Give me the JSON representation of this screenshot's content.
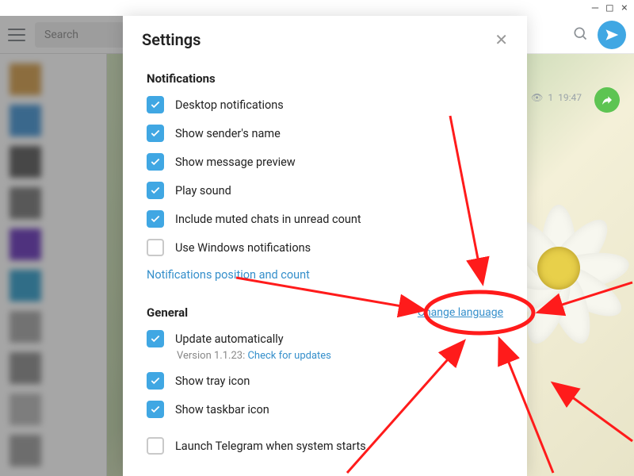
{
  "window": {
    "min": "—",
    "max": "□",
    "close": "×"
  },
  "topbar": {
    "search_placeholder": "Search"
  },
  "chat_meta": {
    "views_icon": "👁",
    "views": "1",
    "time": "19:47"
  },
  "modal": {
    "title": "Settings",
    "close": "✕",
    "notifications": {
      "title": "Notifications",
      "items": [
        {
          "label": "Desktop notifications",
          "checked": true
        },
        {
          "label": "Show sender's name",
          "checked": true
        },
        {
          "label": "Show message preview",
          "checked": true
        },
        {
          "label": "Play sound",
          "checked": true
        },
        {
          "label": "Include muted chats in unread count",
          "checked": true
        },
        {
          "label": "Use Windows notifications",
          "checked": false
        }
      ],
      "position_link": "Notifications position and count"
    },
    "general": {
      "title": "General",
      "change_language": "Change language",
      "update_auto": {
        "label": "Update automatically",
        "checked": true
      },
      "version_prefix": "Version 1.1.23: ",
      "check_updates": "Check for updates",
      "tray": {
        "label": "Show tray icon",
        "checked": true
      },
      "taskbar": {
        "label": "Show taskbar icon",
        "checked": true
      },
      "launch_startup": {
        "label": "Launch Telegram when system starts",
        "checked": false
      }
    }
  },
  "avatar_colors": [
    "#d8a860",
    "#5aa0d8",
    "#6d6d6d",
    "#888888",
    "#7a4ec2",
    "#4aa8d0",
    "#b0b0b0",
    "#9a9a9a",
    "#c0c0c0",
    "#a8a8a8"
  ]
}
